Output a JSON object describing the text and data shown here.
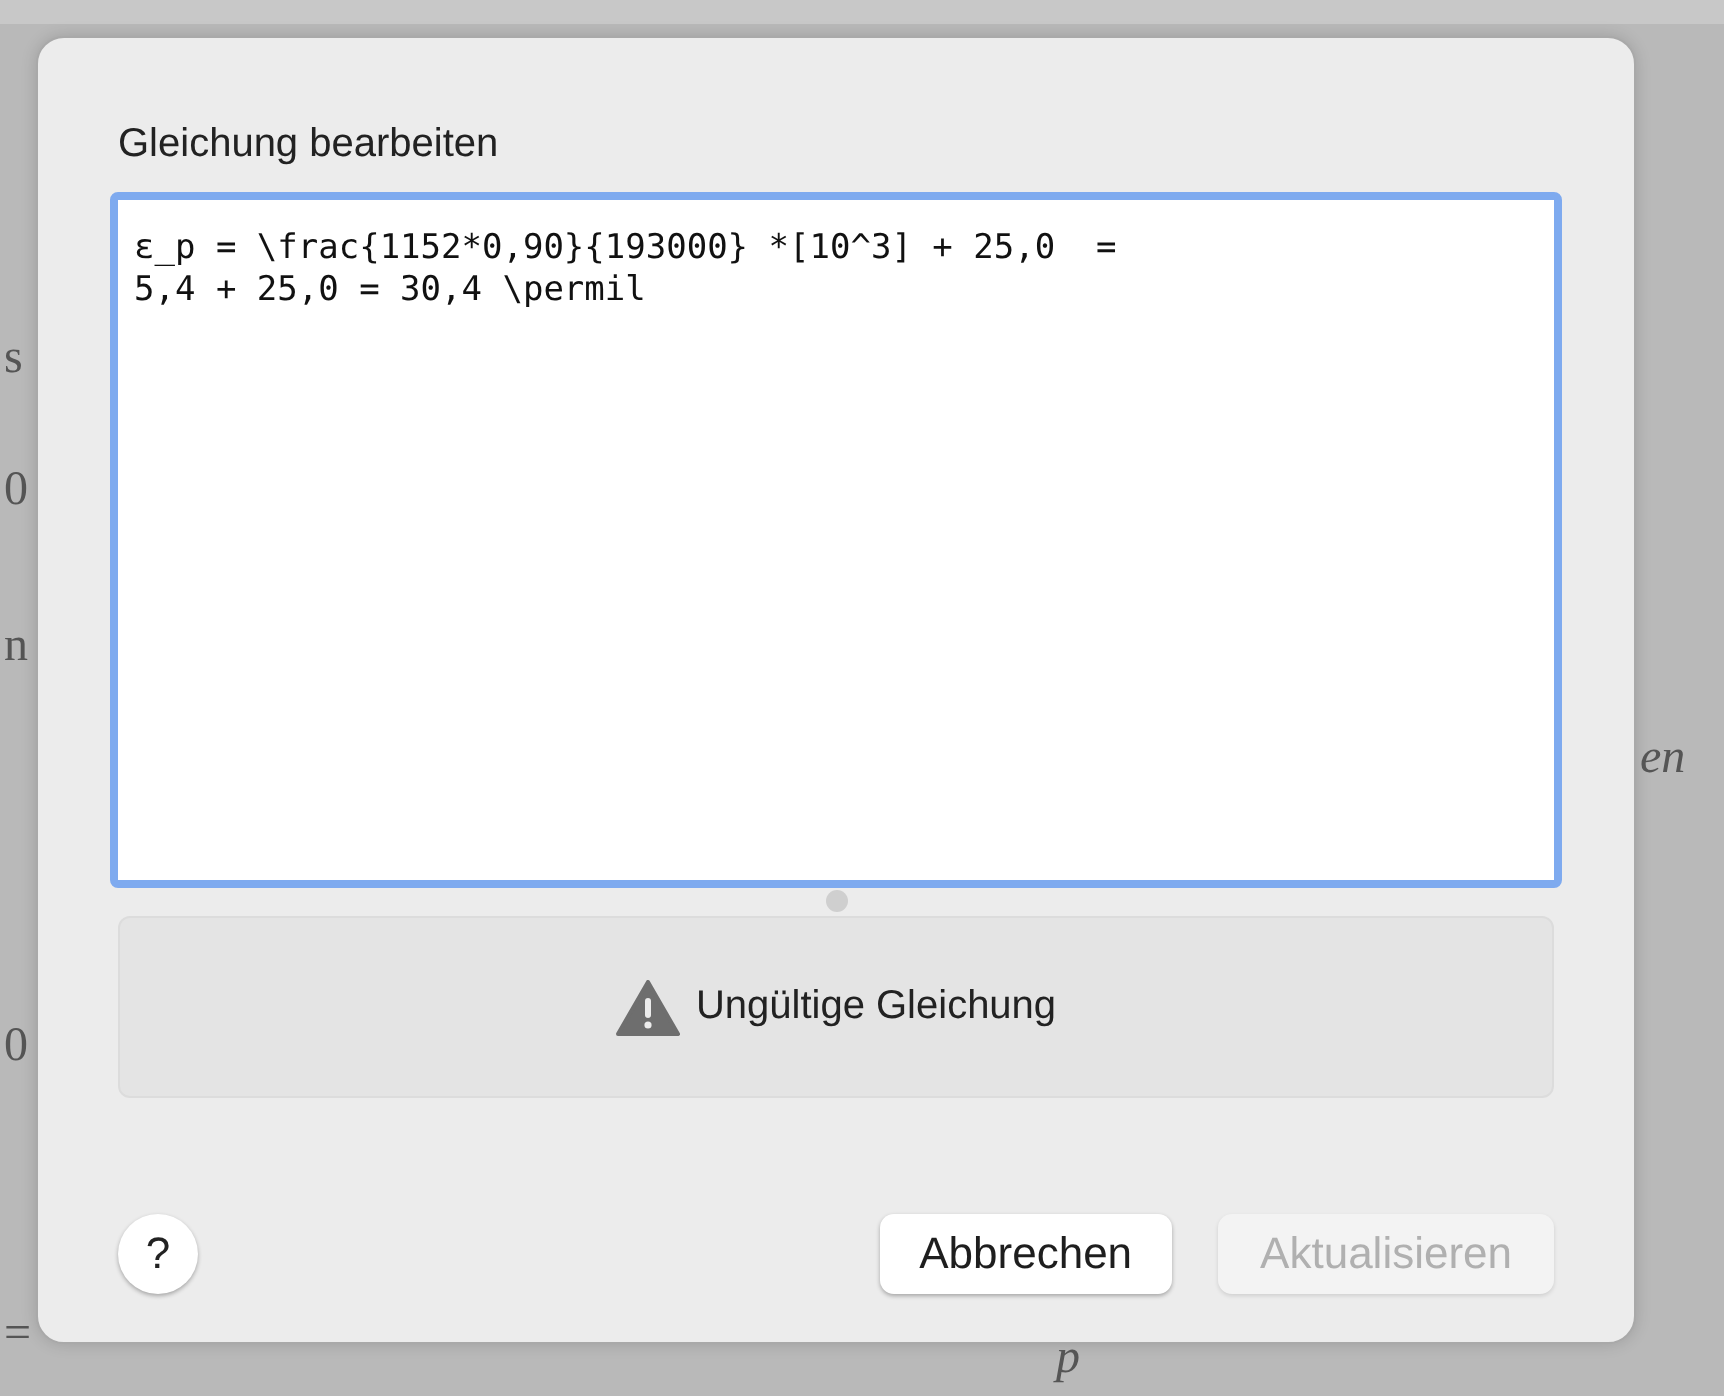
{
  "background": {
    "left_fragments": [
      "s",
      "0",
      "n",
      "0",
      "="
    ],
    "right_fragment": "en",
    "bottom_fragment": "p"
  },
  "dialog": {
    "title": "Gleichung bearbeiten",
    "editor": {
      "value": "ε_p = \\frac{1152*0,90}{193000} *[10^3] + 25,0  =\n5,4 + 25,0 = 30,4 \\permil ",
      "focused": true
    },
    "status": {
      "kind": "warning",
      "message": "Ungültige Gleichung"
    },
    "help": {
      "label": "?"
    },
    "buttons": [
      {
        "label": "Abbrechen",
        "disabled": false
      },
      {
        "label": "Aktualisieren",
        "disabled": true
      }
    ]
  }
}
